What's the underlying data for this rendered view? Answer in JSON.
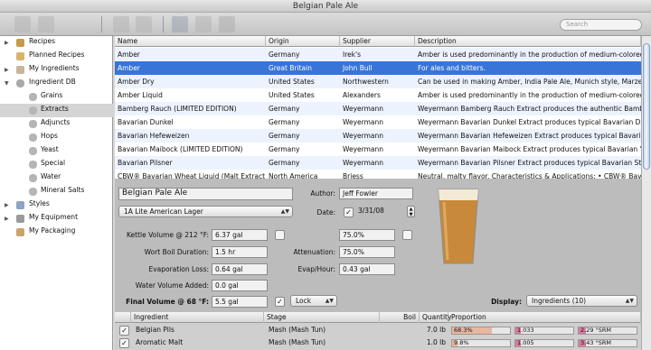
{
  "window": {
    "title": "Belgian Pale Ale"
  },
  "search": {
    "placeholder": "Search"
  },
  "sidebar": {
    "items": [
      {
        "label": "Recipes"
      },
      {
        "label": "Planned Recipes"
      },
      {
        "label": "My Ingredients"
      },
      {
        "label": "Ingredient DB"
      },
      {
        "label": "Grains"
      },
      {
        "label": "Extracts"
      },
      {
        "label": "Adjuncts"
      },
      {
        "label": "Hops"
      },
      {
        "label": "Yeast"
      },
      {
        "label": "Special"
      },
      {
        "label": "Water"
      },
      {
        "label": "Mineral Salts"
      },
      {
        "label": "Styles"
      },
      {
        "label": "My Equipment"
      },
      {
        "label": "My Packaging"
      }
    ]
  },
  "table": {
    "columns": [
      "Name",
      "Origin",
      "Supplier",
      "Description"
    ],
    "rows": [
      [
        "Amber",
        "Germany",
        "Irek's",
        "Amber is used predominantly in the production of medium-colored beers such..."
      ],
      [
        "Amber",
        "Great Britain",
        "John Bull",
        "For ales and bitters."
      ],
      [
        "Amber Dry",
        "United States",
        "Northwestern",
        "Can be used in making Amber, India Pale Ale, Munich style, Marzen, and Bock b..."
      ],
      [
        "Amber Liquid",
        "United States",
        "Alexanders",
        "Amber is used predominantly in the production of medium-colored beers such..."
      ],
      [
        "Bamberg Rauch (LIMITED EDITION)",
        "Germany",
        "Weyermann",
        "Weyermann Bamberg Rauch Extract produces the authentic Bamberg \"Rauchbe..."
      ],
      [
        "Bavarian Dunkel",
        "Germany",
        "Weyermann",
        "Weyermann Bavarian Dunkel Extract produces typical Bavarian Dunkel, Festival ..."
      ],
      [
        "Bavarian Hefeweizen",
        "Germany",
        "Weyermann",
        "Weyermann Bavarian Hefeweizen Extract produces typical Bavarian Weizen Beer..."
      ],
      [
        "Bavarian Maibock (LIMITED EDITION)",
        "Germany",
        "Weyermann",
        "Weyermann Bavarian Maibock Extract produces typical Bavarian \"Maibock\", an a..."
      ],
      [
        "Bavarian Pilsner",
        "Germany",
        "Weyermann",
        "Weyermann Bavarian Pilsner Extract produces typical Bavarian Style Pils and Hell..."
      ],
      [
        "CBW® Bavarian Wheat Liquid (Malt Extract)",
        "North America",
        "Briess",
        "Neutral, malty flavor. Characteristics & Applications: • CBW® Bavarian Wheat is ..."
      ]
    ],
    "selected_index": 1
  },
  "recipe": {
    "name": "Belgian Pale Ale",
    "author_label": "Author:",
    "author": "Jeff Fowler",
    "style": "1A Lite American Lager",
    "date_label": "Date:",
    "date": "3/31/08",
    "kettle_label": "Kettle Volume @ 212 °F:",
    "kettle_value": "6.37 gal",
    "kettle_pct": "75.0%",
    "boil_label": "Wort Boil Duration:",
    "boil_value": "1.5 hr",
    "attenuation_label": "Attenuation:",
    "attenuation_value": "75.0%",
    "evap_label": "Evaporation Loss:",
    "evap_value": "0.64 gal",
    "evaphr_label": "Evap/Hour:",
    "evaphr_value": "0.43 gal",
    "water_label": "Water Volume Added:",
    "water_value": "0.0 gal",
    "final_label": "Final Volume @ 68 °F:",
    "final_value": "5.5 gal",
    "lock_label": "Lock",
    "display_label": "Display:",
    "display_value": "Ingredients (10)"
  },
  "ingredients": {
    "columns": [
      "Ingredient",
      "Stage",
      "Boil",
      "Quantity",
      "Proportion"
    ],
    "rows": [
      {
        "name": "Belgian Pils",
        "stage": "Mash (Mash Tun)",
        "qty": "7.0 lb",
        "prop": "68.3%",
        "grav": "1.033",
        "srm": "2.29 °SRM"
      },
      {
        "name": "Aromatic Malt",
        "stage": "Mash (Mash Tun)",
        "qty": "1.0 lb",
        "prop": "9.8%",
        "grav": "1.005",
        "srm": "3.43 °SRM"
      }
    ]
  },
  "colors": {
    "selection": "#3875d7",
    "beer": "#c8893a"
  }
}
